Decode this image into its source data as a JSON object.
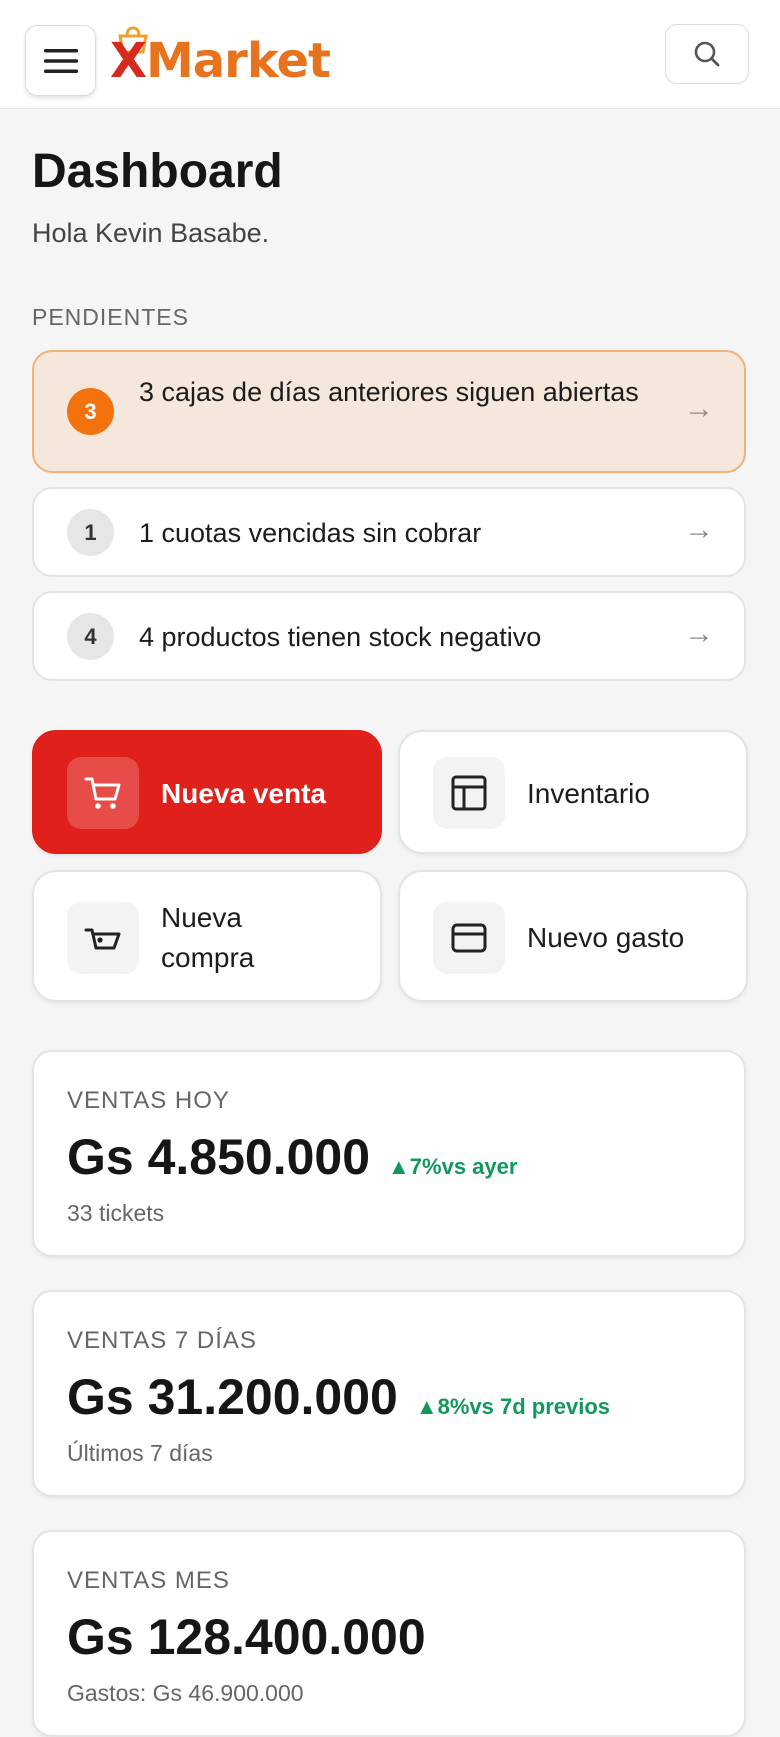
{
  "header": {
    "logo_letter": "X",
    "logo_rest": "Market",
    "menu_icon": "hamburger-icon",
    "search_icon": "search-icon"
  },
  "page": {
    "title": "Dashboard",
    "greeting": "Hola Kevin Basabe."
  },
  "pending": {
    "label": "PENDIENTES",
    "items": [
      {
        "count": "3",
        "text": "3 cajas de días anteriores siguen abiertas",
        "arrow": "→",
        "status": "warning"
      },
      {
        "count": "1",
        "text": "1 cuotas vencidas sin cobrar",
        "arrow": "→",
        "status": "neutral"
      },
      {
        "count": "4",
        "text": "4 productos tienen stock negativo",
        "arrow": "→",
        "status": "neutral"
      }
    ]
  },
  "actions": [
    {
      "label": "Nueva venta",
      "icon": "cart-icon",
      "primary": true
    },
    {
      "label": "Inventario",
      "icon": "table-icon",
      "primary": false
    },
    {
      "label": "Nueva compra",
      "icon": "basket-icon",
      "primary": false
    },
    {
      "label": "Nuevo gasto",
      "icon": "card-icon",
      "primary": false
    }
  ],
  "stats": [
    {
      "label": "VENTAS HOY",
      "value": "Gs 4.850.000",
      "delta": "▲7%vs ayer",
      "sub": "33 tickets"
    },
    {
      "label": "VENTAS 7 DÍAS",
      "value": "Gs 31.200.000",
      "delta": "▲8%vs 7d previos",
      "sub": "Últimos 7 días"
    },
    {
      "label": "VENTAS MES",
      "value": "Gs 128.400.000",
      "delta": "",
      "sub": "Gastos: Gs 46.900.000"
    }
  ],
  "colors": {
    "brand_red": "#e0201b",
    "brand_orange": "#e8731f",
    "warning_bg": "#f5e7dc",
    "warning_badge": "#f2720d",
    "positive": "#12995a"
  }
}
